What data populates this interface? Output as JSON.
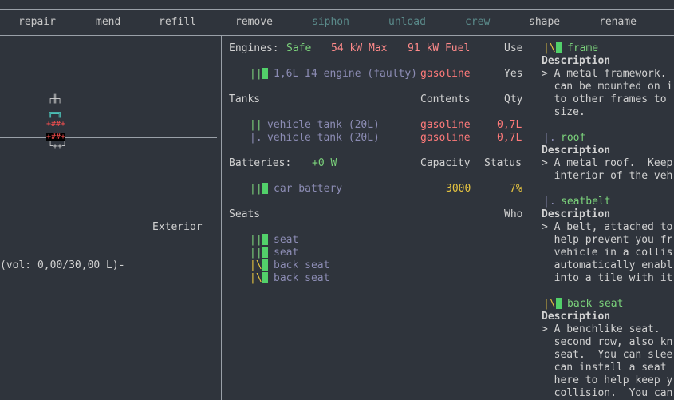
{
  "menu": [
    {
      "label": "repair",
      "color": "#c8c8c8"
    },
    {
      "label": "mend",
      "color": "#c8c8c8"
    },
    {
      "label": "refill",
      "color": "#c8c8c8"
    },
    {
      "label": "remove",
      "color": "#c8c8c8"
    },
    {
      "label": "siphon",
      "color": "#5a8a8a"
    },
    {
      "label": "unload",
      "color": "#5a8a8a"
    },
    {
      "label": "crew",
      "color": "#5a8a8a"
    },
    {
      "label": "shape",
      "color": "#c8c8c8"
    },
    {
      "label": "rename",
      "color": "#c8c8c8"
    }
  ],
  "left": {
    "glyph_top": "┌╫┐",
    "glyph_mid1": "╔═╗",
    "glyph_mid2": "+##+",
    "glyph_mid3": "+##+",
    "glyph_bot": "└++┘",
    "exterior_label": "Exterior",
    "volume_text": "(vol: 0,00/30,00 L)-"
  },
  "engines": {
    "label": "Engines:",
    "safe": "Safe",
    "max": "54 kW Max",
    "fuel": "91 kW Fuel",
    "use_header": "Use",
    "rows": [
      {
        "marker": "||",
        "name": "1,6L I4 engine (faulty)",
        "fuel": "gasoline",
        "use": "Yes"
      }
    ]
  },
  "tanks": {
    "label": "Tanks",
    "contents_header": "Contents",
    "qty_header": "Qty",
    "rows": [
      {
        "marker": "||",
        "name": "vehicle tank (20L)",
        "contents": "gasoline",
        "qty": "0,7L"
      },
      {
        "marker": "|.",
        "name": "vehicle tank (20L)",
        "contents": "gasoline",
        "qty": "0,7L"
      }
    ]
  },
  "batteries": {
    "label": "Batteries:",
    "power": "+0 W",
    "capacity_header": "Capacity",
    "status_header": "Status",
    "rows": [
      {
        "marker": "||",
        "name": "car battery",
        "capacity": "3000",
        "status": "7%"
      }
    ]
  },
  "seats": {
    "label": "Seats",
    "who_header": "Who",
    "rows": [
      {
        "marker": "||",
        "name": "seat"
      },
      {
        "marker": "||",
        "name": "seat"
      },
      {
        "marker": "|\\",
        "name": "back seat"
      },
      {
        "marker": "|\\",
        "name": "back seat"
      }
    ]
  },
  "parts": [
    {
      "marker": "|\\",
      "name": "frame",
      "desc_title": "Description",
      "desc": [
        "> A metal framework.",
        "  can be mounted on i",
        "  to other frames to",
        "  size."
      ]
    },
    {
      "marker": "|.",
      "name": "roof",
      "desc_title": "Description",
      "desc": [
        "> A metal roof.  Keep",
        "  interior of the veh"
      ]
    },
    {
      "marker": "|.",
      "name": "seatbelt",
      "desc_title": "Description",
      "desc": [
        "> A belt, attached to",
        "  help prevent you fr",
        "  vehicle in a collis",
        "  automatically enabl",
        "  into a tile with it"
      ]
    },
    {
      "marker": "|\\",
      "name": "back seat",
      "desc_title": "Description",
      "desc": [
        "> A benchlike seat.",
        "  second row, also kn",
        "  seat.  You can slee",
        "  can install a seat",
        "  here to help keep y",
        "  collision.  You can"
      ]
    }
  ]
}
